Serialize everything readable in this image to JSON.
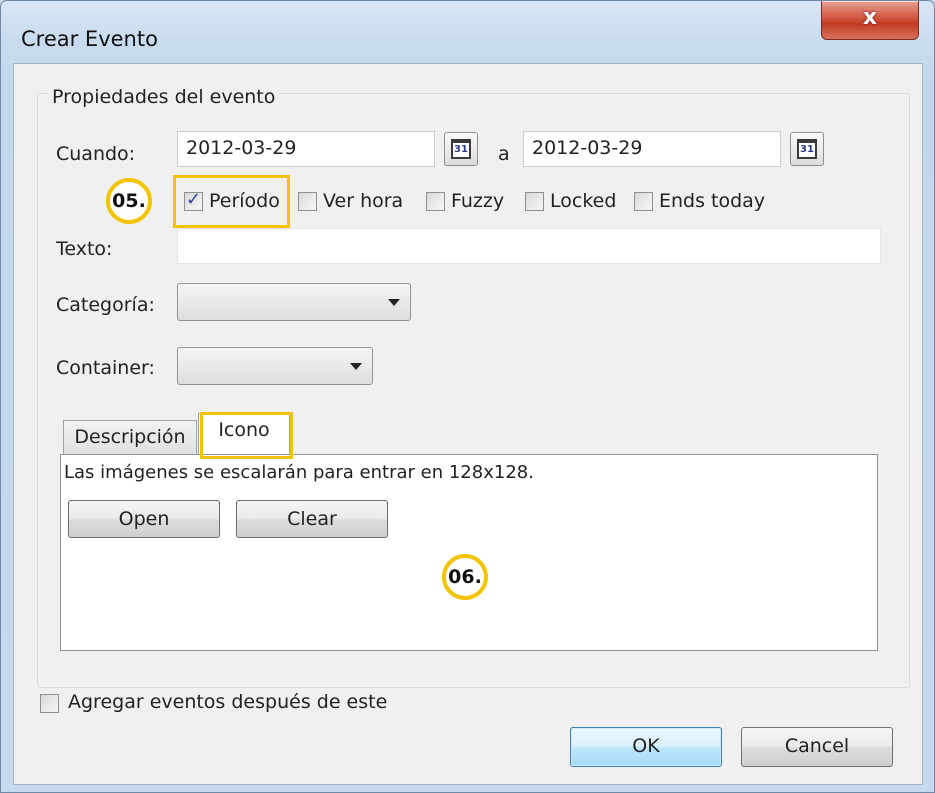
{
  "window": {
    "title": "Crear Evento",
    "close_glyph": "x"
  },
  "group": {
    "title": "Propiedades del evento"
  },
  "when": {
    "label": "Cuando:",
    "start": "2012-03-29",
    "separator": "a",
    "end": "2012-03-29",
    "calendar_icon_text": "31"
  },
  "options": {
    "periodo": {
      "label": "Período",
      "checked": true
    },
    "ver_hora": {
      "label": "Ver hora",
      "checked": false
    },
    "fuzzy": {
      "label": "Fuzzy",
      "checked": false
    },
    "locked": {
      "label": "Locked",
      "checked": false
    },
    "ends_today": {
      "label": "Ends today",
      "checked": false
    }
  },
  "text_field": {
    "label": "Texto:",
    "value": ""
  },
  "category": {
    "label": "Categoría:",
    "value": ""
  },
  "container": {
    "label": "Container:",
    "value": ""
  },
  "tabs": [
    {
      "label": "Descripción",
      "active": false
    },
    {
      "label": "Icono",
      "active": true
    }
  ],
  "icon_tab": {
    "info": "Las imágenes se escalarán para entrar en 128x128.",
    "open_label": "Open",
    "clear_label": "Clear"
  },
  "footer": {
    "add_after_label": "Agregar eventos después de este",
    "ok_label": "OK",
    "cancel_label": "Cancel"
  },
  "annotations": {
    "badge_05": "05.",
    "badge_06": "06.",
    "highlight_color": "#f2c300"
  },
  "check_glyph": "✓"
}
